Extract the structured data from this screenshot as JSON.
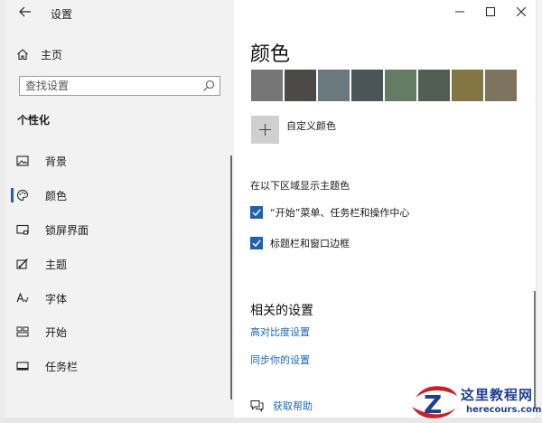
{
  "window": {
    "title": "设置",
    "back_icon": "back-arrow-icon",
    "controls": [
      "minimize-icon",
      "maximize-icon",
      "close-icon"
    ]
  },
  "sidebar": {
    "home_label": "主页",
    "search": {
      "placeholder": "查找设置",
      "value": ""
    },
    "section_title": "个性化",
    "items": [
      {
        "label": "背景",
        "icon": "picture-icon",
        "active": false
      },
      {
        "label": "颜色",
        "icon": "palette-icon",
        "active": true
      },
      {
        "label": "锁屏界面",
        "icon": "lock-screen-icon",
        "active": false
      },
      {
        "label": "主题",
        "icon": "theme-icon",
        "active": false
      },
      {
        "label": "字体",
        "icon": "font-icon",
        "active": false
      },
      {
        "label": "开始",
        "icon": "start-icon",
        "active": false
      },
      {
        "label": "任务栏",
        "icon": "taskbar-icon",
        "active": false
      }
    ]
  },
  "content": {
    "title": "颜色",
    "swatches": [
      "#767676",
      "#4c4a48",
      "#69797e",
      "#4a5459",
      "#647c64",
      "#525e54",
      "#847545",
      "#7e735f"
    ],
    "custom_color_label": "自定义颜色",
    "accent_surfaces_heading": "在以下区域显示主题色",
    "checkboxes": [
      {
        "label": "“开始”菜单、任务栏和操作中心",
        "checked": true
      },
      {
        "label": "标题栏和窗口边框",
        "checked": true
      }
    ],
    "related_title": "相关的设置",
    "links": [
      "高对比度设置",
      "同步你的设置"
    ],
    "help_label": "获取帮助"
  },
  "watermark": {
    "name": "这里教程网",
    "url": "herecours.com"
  },
  "colors": {
    "accent": "#1f5fb4",
    "link": "#1a66c2",
    "sidebar_bg": "#f2f2f2"
  }
}
